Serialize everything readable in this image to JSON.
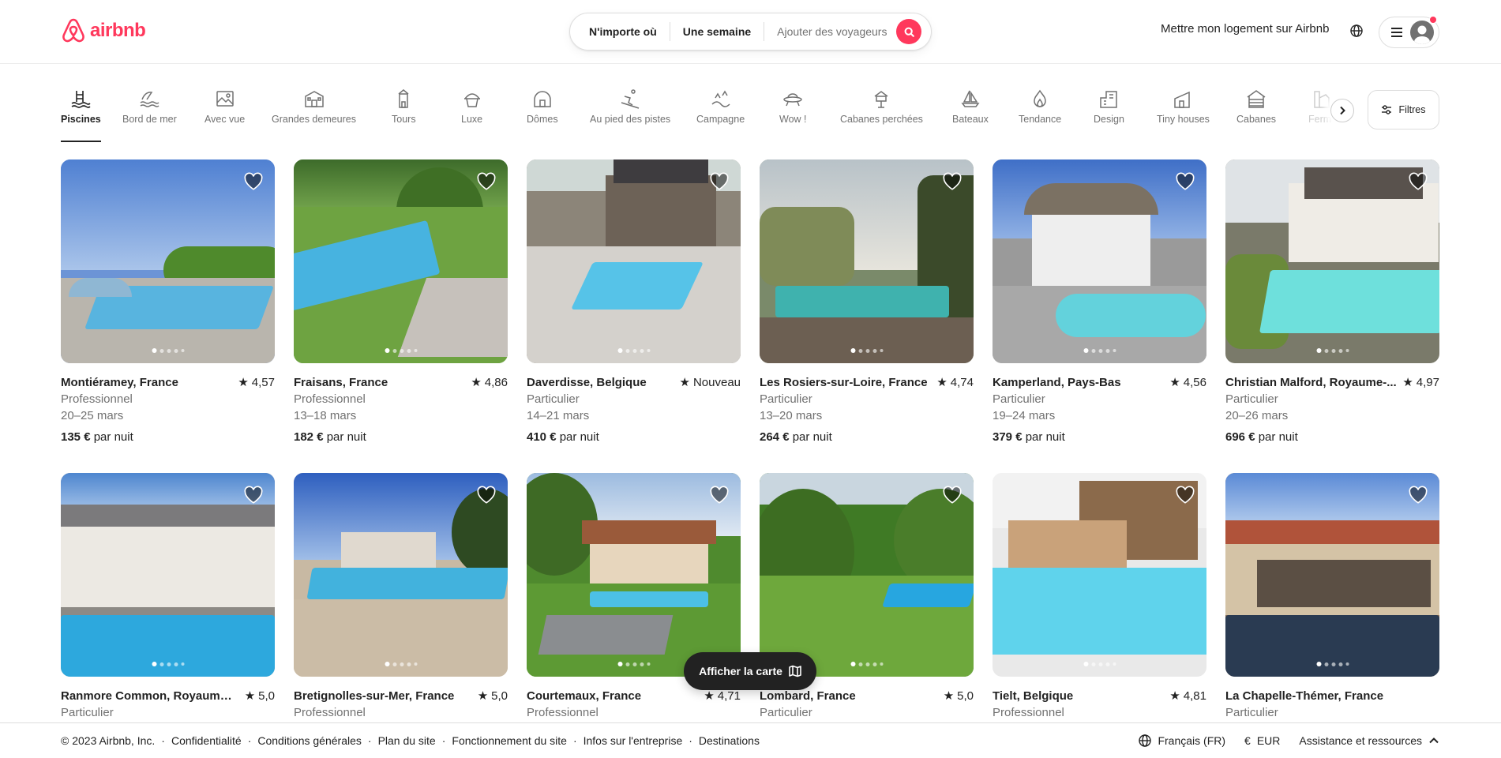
{
  "header": {
    "brand": "airbnb",
    "search": {
      "where": "N'importe où",
      "when": "Une semaine",
      "who": "Ajouter des voyageurs"
    },
    "host_link": "Mettre mon logement sur Airbnb"
  },
  "categories": [
    {
      "label": "Piscines",
      "icon": "pool-icon"
    },
    {
      "label": "Bord de mer",
      "icon": "beach-icon"
    },
    {
      "label": "Avec vue",
      "icon": "view-icon"
    },
    {
      "label": "Grandes demeures",
      "icon": "mansion-icon"
    },
    {
      "label": "Tours",
      "icon": "tower-icon"
    },
    {
      "label": "Luxe",
      "icon": "luxe-icon"
    },
    {
      "label": "Dômes",
      "icon": "dome-icon"
    },
    {
      "label": "Au pied des pistes",
      "icon": "ski-icon"
    },
    {
      "label": "Campagne",
      "icon": "countryside-icon"
    },
    {
      "label": "Wow !",
      "icon": "ufo-icon"
    },
    {
      "label": "Cabanes perchées",
      "icon": "treehouse-icon"
    },
    {
      "label": "Bateaux",
      "icon": "boat-icon"
    },
    {
      "label": "Tendance",
      "icon": "flame-icon"
    },
    {
      "label": "Design",
      "icon": "design-icon"
    },
    {
      "label": "Tiny houses",
      "icon": "tiny-house-icon"
    },
    {
      "label": "Cabanes",
      "icon": "cabin-icon"
    },
    {
      "label": "Ferm",
      "icon": "farm-icon"
    }
  ],
  "filters_label": "Filtres",
  "listings": [
    {
      "location": "Montiéramey, France",
      "rating": "4,57",
      "host": "Professionnel",
      "dates": "20–25 mars",
      "price": "135 €",
      "per": "par nuit"
    },
    {
      "location": "Fraisans, France",
      "rating": "4,86",
      "host": "Professionnel",
      "dates": "13–18 mars",
      "price": "182 €",
      "per": "par nuit"
    },
    {
      "location": "Daverdisse, Belgique",
      "rating": "Nouveau",
      "host": "Particulier",
      "dates": "14–21 mars",
      "price": "410 €",
      "per": "par nuit"
    },
    {
      "location": "Les Rosiers-sur-Loire, France",
      "rating": "4,74",
      "host": "Particulier",
      "dates": "13–20 mars",
      "price": "264 €",
      "per": "par nuit"
    },
    {
      "location": "Kamperland, Pays-Bas",
      "rating": "4,56",
      "host": "Particulier",
      "dates": "19–24 mars",
      "price": "379 €",
      "per": "par nuit"
    },
    {
      "location": "Christian Malford, Royaume-...",
      "rating": "4,97",
      "host": "Particulier",
      "dates": "20–26 mars",
      "price": "696 €",
      "per": "par nuit"
    },
    {
      "location": "Ranmore Common, Royaume-...",
      "rating": "5,0",
      "host": "Particulier"
    },
    {
      "location": "Bretignolles-sur-Mer, France",
      "rating": "5,0",
      "host": "Professionnel"
    },
    {
      "location": "Courtemaux, France",
      "rating": "4,71",
      "host": "Professionnel"
    },
    {
      "location": "Lombard, France",
      "rating": "5,0",
      "host": "Particulier"
    },
    {
      "location": "Tielt, Belgique",
      "rating": "4,81",
      "host": "Professionnel"
    },
    {
      "location": "La Chapelle-Thémer, France",
      "rating": "",
      "host": "Particulier"
    }
  ],
  "map_button": "Afficher la carte",
  "footer": {
    "copyright": "© 2023 Airbnb, Inc.",
    "links": [
      "Confidentialité",
      "Conditions générales",
      "Plan du site",
      "Fonctionnement du site",
      "Infos sur l'entreprise",
      "Destinations"
    ],
    "language": "Français (FR)",
    "currency_symbol": "€",
    "currency": "EUR",
    "support": "Assistance et ressources"
  },
  "colors": {
    "brand": "#ff385c",
    "text": "#222222",
    "muted": "#717171"
  }
}
